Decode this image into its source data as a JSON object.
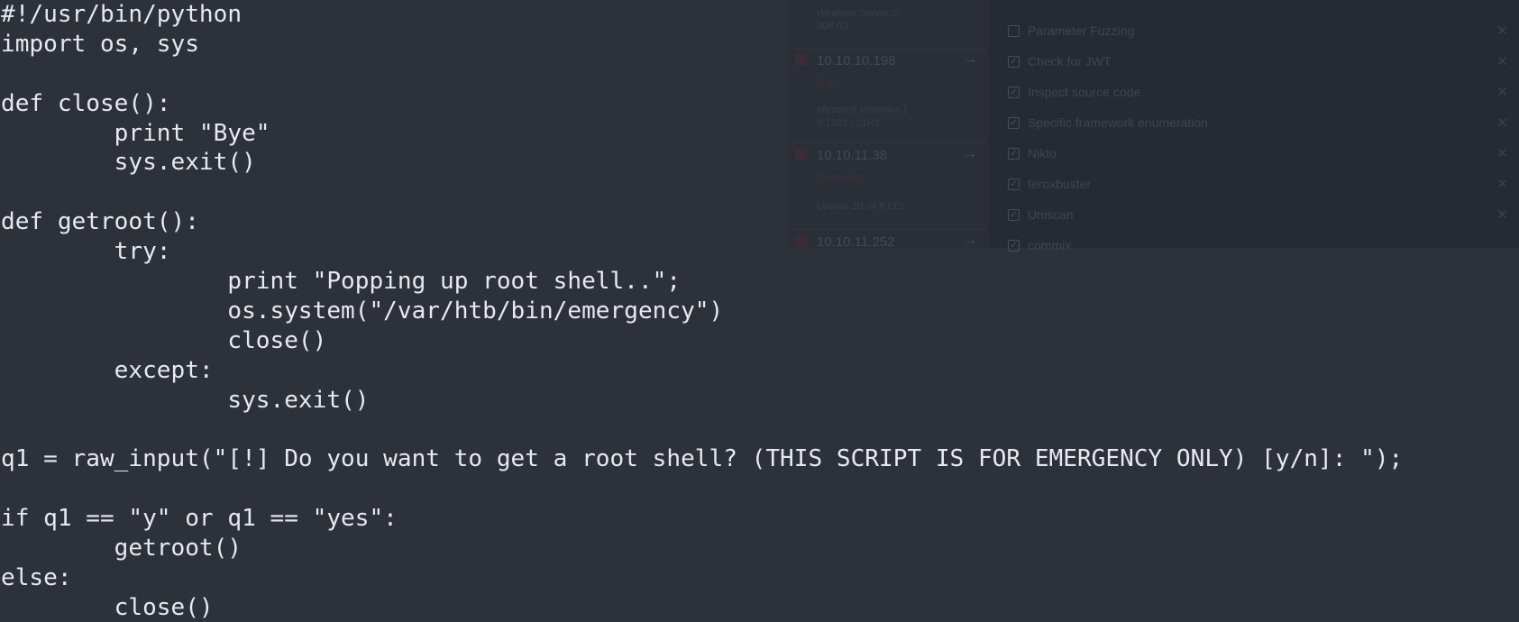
{
  "terminal": {
    "lines": [
      "#!/usr/bin/python",
      "import os, sys",
      "",
      "def close():",
      "        print \"Bye\"",
      "        sys.exit()",
      "",
      "def getroot():",
      "        try:",
      "                print \"Popping up root shell..\";",
      "                os.system(\"/var/htb/bin/emergency\")",
      "                close()",
      "        except:",
      "                sys.exit()",
      "",
      "q1 = raw_input(\"[!] Do you want to get a root shell? (THIS SCRIPT IS FOR EMERGENCY ONLY) [y/n]: \");",
      "",
      "if q1 == \"y\" or q1 == \"yes\":",
      "        getroot()",
      "else:",
      "        close()"
    ]
  },
  "background_app": {
    "hosts": [
      {
        "ip": "",
        "name": "",
        "os_line1": "Windows Server 2",
        "os_line2": "008 R2"
      },
      {
        "ip": "10.10.10.198",
        "name": "Buff",
        "os_line1": "Microsoft Windows 1",
        "os_line2": "0 1903 - 21H1"
      },
      {
        "ip": "10.10.11.38",
        "name": "Chemistry",
        "os_line1": "Ubuntu 20.04.6 LTS",
        "os_line2": ""
      },
      {
        "ip": "10.10.11.252",
        "name": "",
        "os_line1": "",
        "os_line2": ""
      }
    ],
    "checklist": [
      {
        "label": "Parameter Fuzzing",
        "checked": false
      },
      {
        "label": "Check for JWT",
        "checked": true
      },
      {
        "label": "Inspect source code",
        "checked": true
      },
      {
        "label": "Specific framework enumeration",
        "checked": true
      },
      {
        "label": "Nikto",
        "checked": true
      },
      {
        "label": "feroxbuster",
        "checked": true
      },
      {
        "label": "Uniscan",
        "checked": true
      },
      {
        "label": "commix",
        "checked": true
      }
    ],
    "colors": {
      "terminal_bg": "#2d313a",
      "terminal_fg": "#e7e9ee",
      "overlay_bg": "#262a32"
    },
    "icons": {
      "check": "checkbox-icon",
      "remove": "close-icon",
      "open": "arrow-right-icon"
    }
  }
}
